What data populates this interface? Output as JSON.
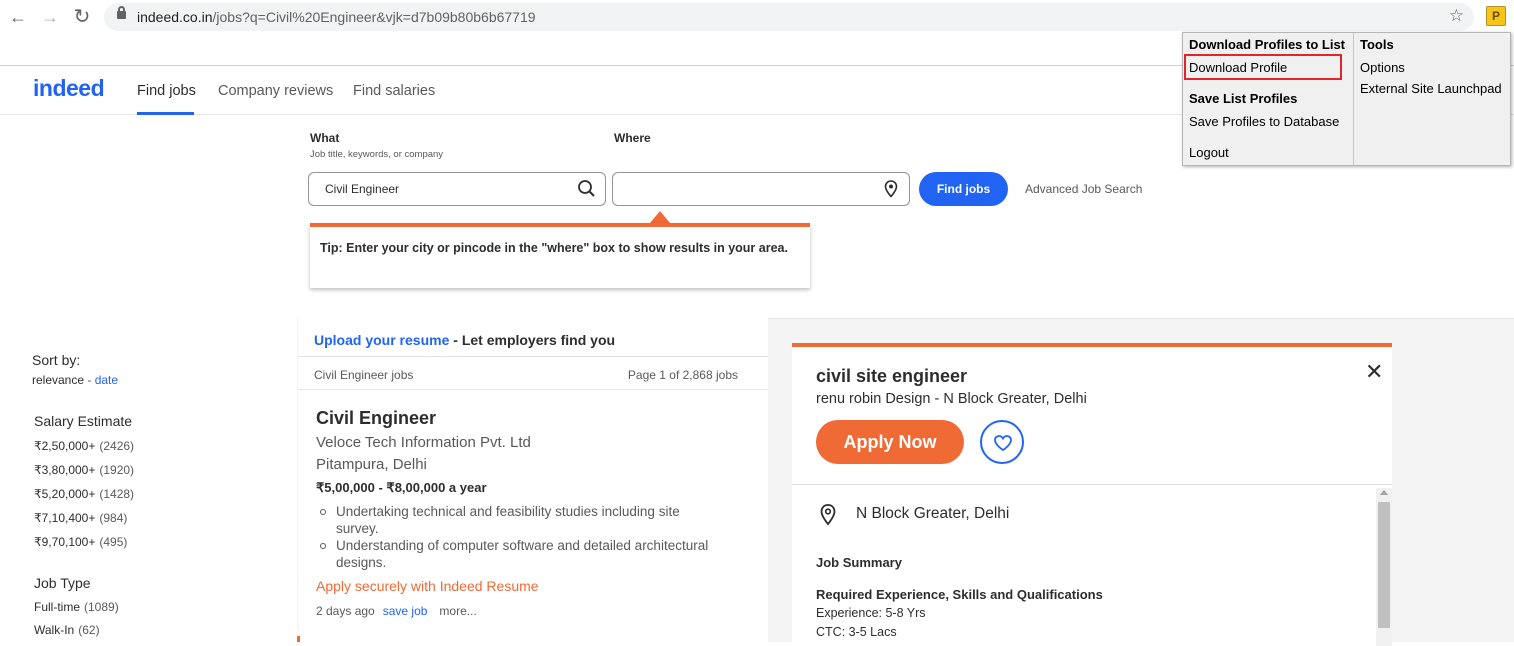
{
  "browser": {
    "back_icon": "back-arrow-icon",
    "forward_icon": "forward-arrow-icon",
    "reload_icon": "reload-icon",
    "url_domain": "indeed.co.in",
    "url_path": "/jobs?q=Civil%20Engineer&vjk=d7b09b80b6b67719",
    "extension_badge": "P"
  },
  "header": {
    "logo": "indeed",
    "nav": [
      "Find jobs",
      "Company reviews",
      "Find salaries"
    ]
  },
  "search": {
    "what_label": "What",
    "what_sublabel": "Job title, keywords, or company",
    "what_value": "Civil Engineer",
    "where_label": "Where",
    "where_value": "",
    "find_button": "Find jobs",
    "advanced_link": "Advanced Job Search",
    "tip_bold": "Tip:",
    "tip_text": " Enter your city or pincode in the \"where\" box to show results in your area."
  },
  "filters": {
    "sort_by_label": "Sort by:",
    "sort_relevance": "relevance",
    "sort_separator": " - ",
    "sort_date": "date",
    "salary_heading": "Salary Estimate",
    "salary": [
      {
        "label": "₹2,50,000+",
        "count": "(2426)"
      },
      {
        "label": "₹3,80,000+",
        "count": "(1920)"
      },
      {
        "label": "₹5,20,000+",
        "count": "(1428)"
      },
      {
        "label": "₹7,10,400+",
        "count": "(984)"
      },
      {
        "label": "₹9,70,100+",
        "count": "(495)"
      }
    ],
    "jobtype_heading": "Job Type",
    "jobtype": [
      {
        "label": "Full-time",
        "count": "(1089)"
      },
      {
        "label": "Walk-In",
        "count": "(62)"
      }
    ]
  },
  "results": {
    "upload_link": "Upload your resume",
    "upload_rest": " - Let employers find you",
    "query_label": "Civil Engineer jobs",
    "page_info": "Page 1 of 2,868 jobs",
    "job": {
      "title": "Civil Engineer",
      "company": "Veloce Tech Information Pvt. Ltd",
      "location": "Pitampura, Delhi",
      "salary": "₹5,00,000 - ₹8,00,000 a year",
      "bullets": [
        "Undertaking technical and feasibility studies including site survey.",
        "Understanding of computer software and detailed architectural designs."
      ],
      "apply_text": "Apply securely with Indeed Resume",
      "posted": "2 days ago",
      "save": "save job",
      "more": "more..."
    }
  },
  "detail": {
    "title": "civil site engineer",
    "subtitle": "renu robin Design - N Block Greater, Delhi",
    "apply_button": "Apply Now",
    "location": "N Block Greater, Delhi",
    "summary_heading": "Job Summary",
    "req_heading": "Required Experience, Skills and Qualifications",
    "lines": [
      "Experience: 5-8 Yrs",
      "CTC: 3-5 Lacs"
    ]
  },
  "popup": {
    "col1_heading": "Download Profiles to List",
    "download_profile": "Download Profile",
    "save_list_heading": "Save List Profiles",
    "save_to_db": "Save Profiles to Database",
    "logout": "Logout",
    "col2_heading": "Tools",
    "options": "Options",
    "launchpad": "External Site Launchpad"
  },
  "colors": {
    "brand_blue": "#2164f3",
    "accent_orange": "#f06a35",
    "highlight_red": "#e3252a"
  }
}
